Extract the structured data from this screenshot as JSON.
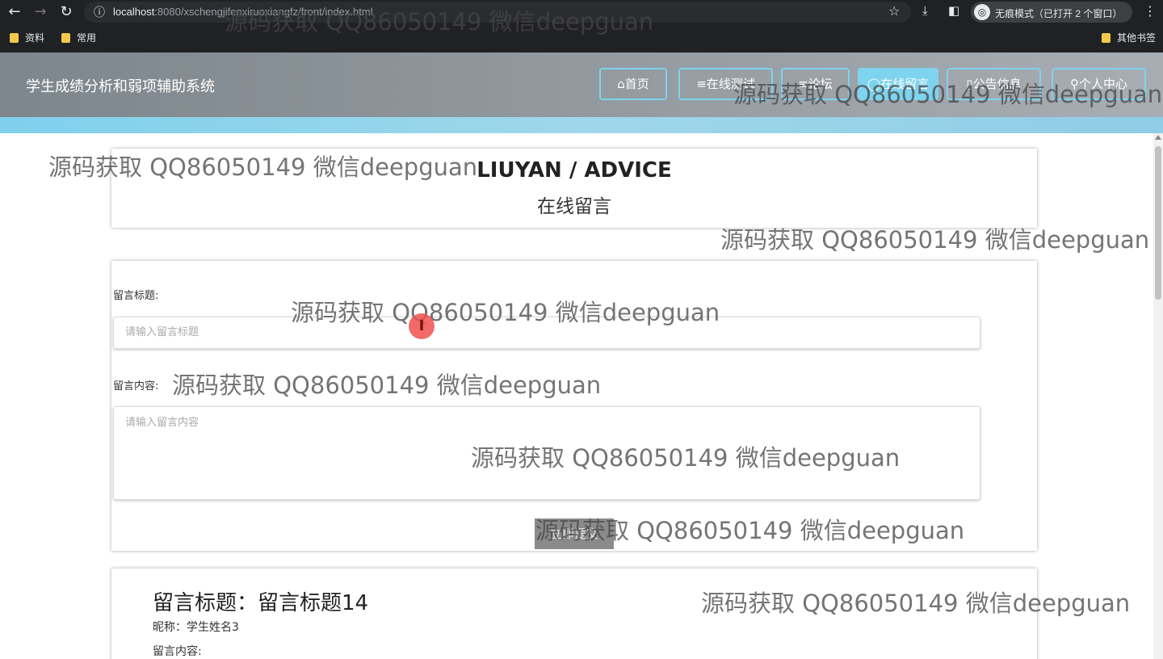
{
  "browser": {
    "back_icon": "←",
    "forward_icon": "→",
    "reload_icon": "↻",
    "info_icon": "ⓘ",
    "url_host": "localhost",
    "url_path": ":8080/xschengjifenxiruoxiangfz/front/index.html",
    "bookmark_star": "☆",
    "download_icon": "⤓",
    "sidepanel_icon": "◧",
    "incognito_label": "无痕模式（已打开 2 个窗口）",
    "menu_icon": "⋮",
    "bookmarks": [
      "资料",
      "常用"
    ],
    "other_bookmarks": "其他书签"
  },
  "site": {
    "title": "学生成绩分析和弱项辅助系统",
    "nav": [
      {
        "label": "⌂首页",
        "active": false
      },
      {
        "label": "≡在线测试",
        "active": false
      },
      {
        "label": "≡论坛",
        "active": false
      },
      {
        "label": "◯在线留言",
        "active": true
      },
      {
        "label": "▯公告信息",
        "active": false
      },
      {
        "label": "⚲个人中心",
        "active": false
      }
    ]
  },
  "header_card": {
    "title_en": "LIUYAN / ADVICE",
    "title_cn": "在线留言"
  },
  "form": {
    "title_label": "留言标题:",
    "title_placeholder": "请输入留言标题",
    "content_label": "留言内容:",
    "content_placeholder": "请输入留言内容",
    "submit_label": "立即提交"
  },
  "messages": [
    {
      "title": "留言标题：留言标题14",
      "nickname": "昵称：学生姓名3",
      "content_label": "留言内容:"
    }
  ],
  "watermark_text": "源码获取 QQ86050149 微信deepguan",
  "cursor_glyph": "I"
}
